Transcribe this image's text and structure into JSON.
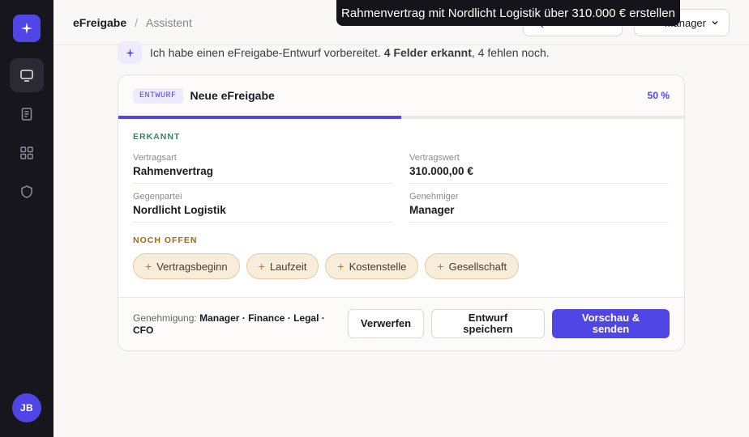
{
  "rail": {
    "logo_icon": "sparkle-icon",
    "items": [
      {
        "icon": "monitor-icon",
        "active": true
      },
      {
        "icon": "document-icon",
        "active": false
      },
      {
        "icon": "grid-icon",
        "active": false
      },
      {
        "icon": "shield-icon",
        "active": false
      }
    ],
    "avatar": "JB"
  },
  "header": {
    "app": "eFreigabe",
    "separator": "/",
    "page": "Assistent",
    "role_label": "Manager"
  },
  "tooltip": "Rahmenvertrag mit Nordlicht Logistik über 310.000 € erstellen",
  "assistant": {
    "prefix": "Ich habe einen eFreigabe-Entwurf vorbereitet.",
    "recognized": "4 Felder erkannt",
    "suffix": ", 4 fehlen noch."
  },
  "card": {
    "badge": "ENTWURF",
    "title": "Neue eFreigabe",
    "progress_label": "50 %",
    "progress": 0.5,
    "recognized_label": "ERKANNT",
    "fields": [
      {
        "label": "Vertragsart",
        "value": "Rahmenvertrag"
      },
      {
        "label": "Vertragswert",
        "value": "310.000,00 €"
      },
      {
        "label": "Gegenpartei",
        "value": "Nordlicht Logistik"
      },
      {
        "label": "Genehmiger",
        "value": "Manager"
      }
    ],
    "open_label": "NOCH OFFEN",
    "open_fields": [
      "Vertragsbeginn",
      "Laufzeit",
      "Kostenstelle",
      "Gesellschaft"
    ],
    "footer": {
      "approval_prefix": "Genehmigung:",
      "approval_chain": "Manager · Finance · Legal · CFO",
      "discard": "Verwerfen",
      "save": "Entwurf speichern",
      "send": "Vorschau & senden"
    }
  },
  "colors": {
    "accent": "#4f46e5",
    "recognized": "#2f8a5e",
    "open": "#a8650f"
  }
}
